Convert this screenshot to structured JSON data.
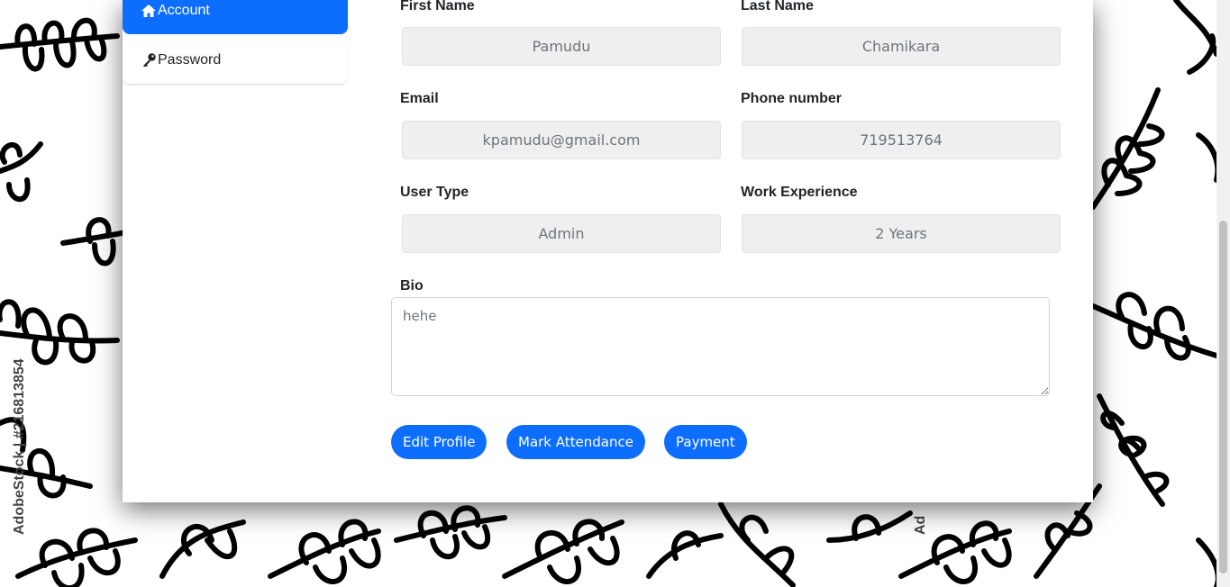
{
  "watermark": "AdobeStock | #216813854",
  "sidebar": {
    "items": [
      {
        "label": "Account",
        "icon": "home-icon",
        "active": true
      },
      {
        "label": "Password",
        "icon": "key-icon",
        "active": false
      }
    ]
  },
  "form": {
    "first_name": {
      "label": "First Name",
      "value": "Pamudu"
    },
    "last_name": {
      "label": "Last Name",
      "value": "Chamikara"
    },
    "email": {
      "label": "Email",
      "value": "kpamudu@gmail.com"
    },
    "phone": {
      "label": "Phone number",
      "value": "719513764"
    },
    "user_type": {
      "label": "User Type",
      "value": "Admin"
    },
    "work_experience": {
      "label": "Work Experience",
      "value": "2 Years"
    },
    "bio": {
      "label": "Bio",
      "value": "hehe"
    }
  },
  "actions": {
    "edit_profile": "Edit Profile",
    "mark_attendance": "Mark Attendance",
    "payment": "Payment"
  },
  "colors": {
    "primary": "#0d6efd",
    "input_bg": "#efefef",
    "label": "#212529"
  }
}
